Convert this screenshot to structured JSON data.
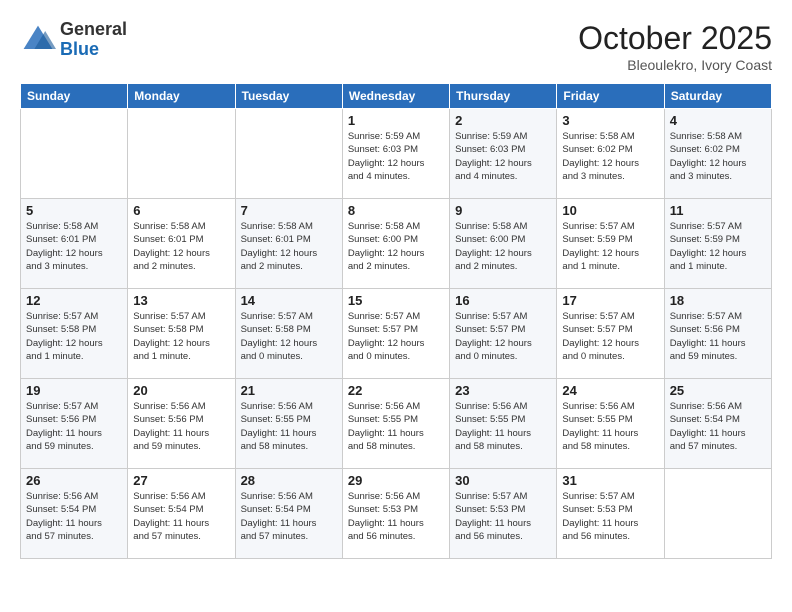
{
  "header": {
    "logo": {
      "general": "General",
      "blue": "Blue"
    },
    "title": "October 2025",
    "subtitle": "Bleoulekro, Ivory Coast"
  },
  "weekdays": [
    "Sunday",
    "Monday",
    "Tuesday",
    "Wednesday",
    "Thursday",
    "Friday",
    "Saturday"
  ],
  "weeks": [
    [
      {
        "day": "",
        "info": ""
      },
      {
        "day": "",
        "info": ""
      },
      {
        "day": "",
        "info": ""
      },
      {
        "day": "1",
        "info": "Sunrise: 5:59 AM\nSunset: 6:03 PM\nDaylight: 12 hours\nand 4 minutes."
      },
      {
        "day": "2",
        "info": "Sunrise: 5:59 AM\nSunset: 6:03 PM\nDaylight: 12 hours\nand 4 minutes."
      },
      {
        "day": "3",
        "info": "Sunrise: 5:58 AM\nSunset: 6:02 PM\nDaylight: 12 hours\nand 3 minutes."
      },
      {
        "day": "4",
        "info": "Sunrise: 5:58 AM\nSunset: 6:02 PM\nDaylight: 12 hours\nand 3 minutes."
      }
    ],
    [
      {
        "day": "5",
        "info": "Sunrise: 5:58 AM\nSunset: 6:01 PM\nDaylight: 12 hours\nand 3 minutes."
      },
      {
        "day": "6",
        "info": "Sunrise: 5:58 AM\nSunset: 6:01 PM\nDaylight: 12 hours\nand 2 minutes."
      },
      {
        "day": "7",
        "info": "Sunrise: 5:58 AM\nSunset: 6:01 PM\nDaylight: 12 hours\nand 2 minutes."
      },
      {
        "day": "8",
        "info": "Sunrise: 5:58 AM\nSunset: 6:00 PM\nDaylight: 12 hours\nand 2 minutes."
      },
      {
        "day": "9",
        "info": "Sunrise: 5:58 AM\nSunset: 6:00 PM\nDaylight: 12 hours\nand 2 minutes."
      },
      {
        "day": "10",
        "info": "Sunrise: 5:57 AM\nSunset: 5:59 PM\nDaylight: 12 hours\nand 1 minute."
      },
      {
        "day": "11",
        "info": "Sunrise: 5:57 AM\nSunset: 5:59 PM\nDaylight: 12 hours\nand 1 minute."
      }
    ],
    [
      {
        "day": "12",
        "info": "Sunrise: 5:57 AM\nSunset: 5:58 PM\nDaylight: 12 hours\nand 1 minute."
      },
      {
        "day": "13",
        "info": "Sunrise: 5:57 AM\nSunset: 5:58 PM\nDaylight: 12 hours\nand 1 minute."
      },
      {
        "day": "14",
        "info": "Sunrise: 5:57 AM\nSunset: 5:58 PM\nDaylight: 12 hours\nand 0 minutes."
      },
      {
        "day": "15",
        "info": "Sunrise: 5:57 AM\nSunset: 5:57 PM\nDaylight: 12 hours\nand 0 minutes."
      },
      {
        "day": "16",
        "info": "Sunrise: 5:57 AM\nSunset: 5:57 PM\nDaylight: 12 hours\nand 0 minutes."
      },
      {
        "day": "17",
        "info": "Sunrise: 5:57 AM\nSunset: 5:57 PM\nDaylight: 12 hours\nand 0 minutes."
      },
      {
        "day": "18",
        "info": "Sunrise: 5:57 AM\nSunset: 5:56 PM\nDaylight: 11 hours\nand 59 minutes."
      }
    ],
    [
      {
        "day": "19",
        "info": "Sunrise: 5:57 AM\nSunset: 5:56 PM\nDaylight: 11 hours\nand 59 minutes."
      },
      {
        "day": "20",
        "info": "Sunrise: 5:56 AM\nSunset: 5:56 PM\nDaylight: 11 hours\nand 59 minutes."
      },
      {
        "day": "21",
        "info": "Sunrise: 5:56 AM\nSunset: 5:55 PM\nDaylight: 11 hours\nand 58 minutes."
      },
      {
        "day": "22",
        "info": "Sunrise: 5:56 AM\nSunset: 5:55 PM\nDaylight: 11 hours\nand 58 minutes."
      },
      {
        "day": "23",
        "info": "Sunrise: 5:56 AM\nSunset: 5:55 PM\nDaylight: 11 hours\nand 58 minutes."
      },
      {
        "day": "24",
        "info": "Sunrise: 5:56 AM\nSunset: 5:55 PM\nDaylight: 11 hours\nand 58 minutes."
      },
      {
        "day": "25",
        "info": "Sunrise: 5:56 AM\nSunset: 5:54 PM\nDaylight: 11 hours\nand 57 minutes."
      }
    ],
    [
      {
        "day": "26",
        "info": "Sunrise: 5:56 AM\nSunset: 5:54 PM\nDaylight: 11 hours\nand 57 minutes."
      },
      {
        "day": "27",
        "info": "Sunrise: 5:56 AM\nSunset: 5:54 PM\nDaylight: 11 hours\nand 57 minutes."
      },
      {
        "day": "28",
        "info": "Sunrise: 5:56 AM\nSunset: 5:54 PM\nDaylight: 11 hours\nand 57 minutes."
      },
      {
        "day": "29",
        "info": "Sunrise: 5:56 AM\nSunset: 5:53 PM\nDaylight: 11 hours\nand 56 minutes."
      },
      {
        "day": "30",
        "info": "Sunrise: 5:57 AM\nSunset: 5:53 PM\nDaylight: 11 hours\nand 56 minutes."
      },
      {
        "day": "31",
        "info": "Sunrise: 5:57 AM\nSunset: 5:53 PM\nDaylight: 11 hours\nand 56 minutes."
      },
      {
        "day": "",
        "info": ""
      }
    ]
  ]
}
